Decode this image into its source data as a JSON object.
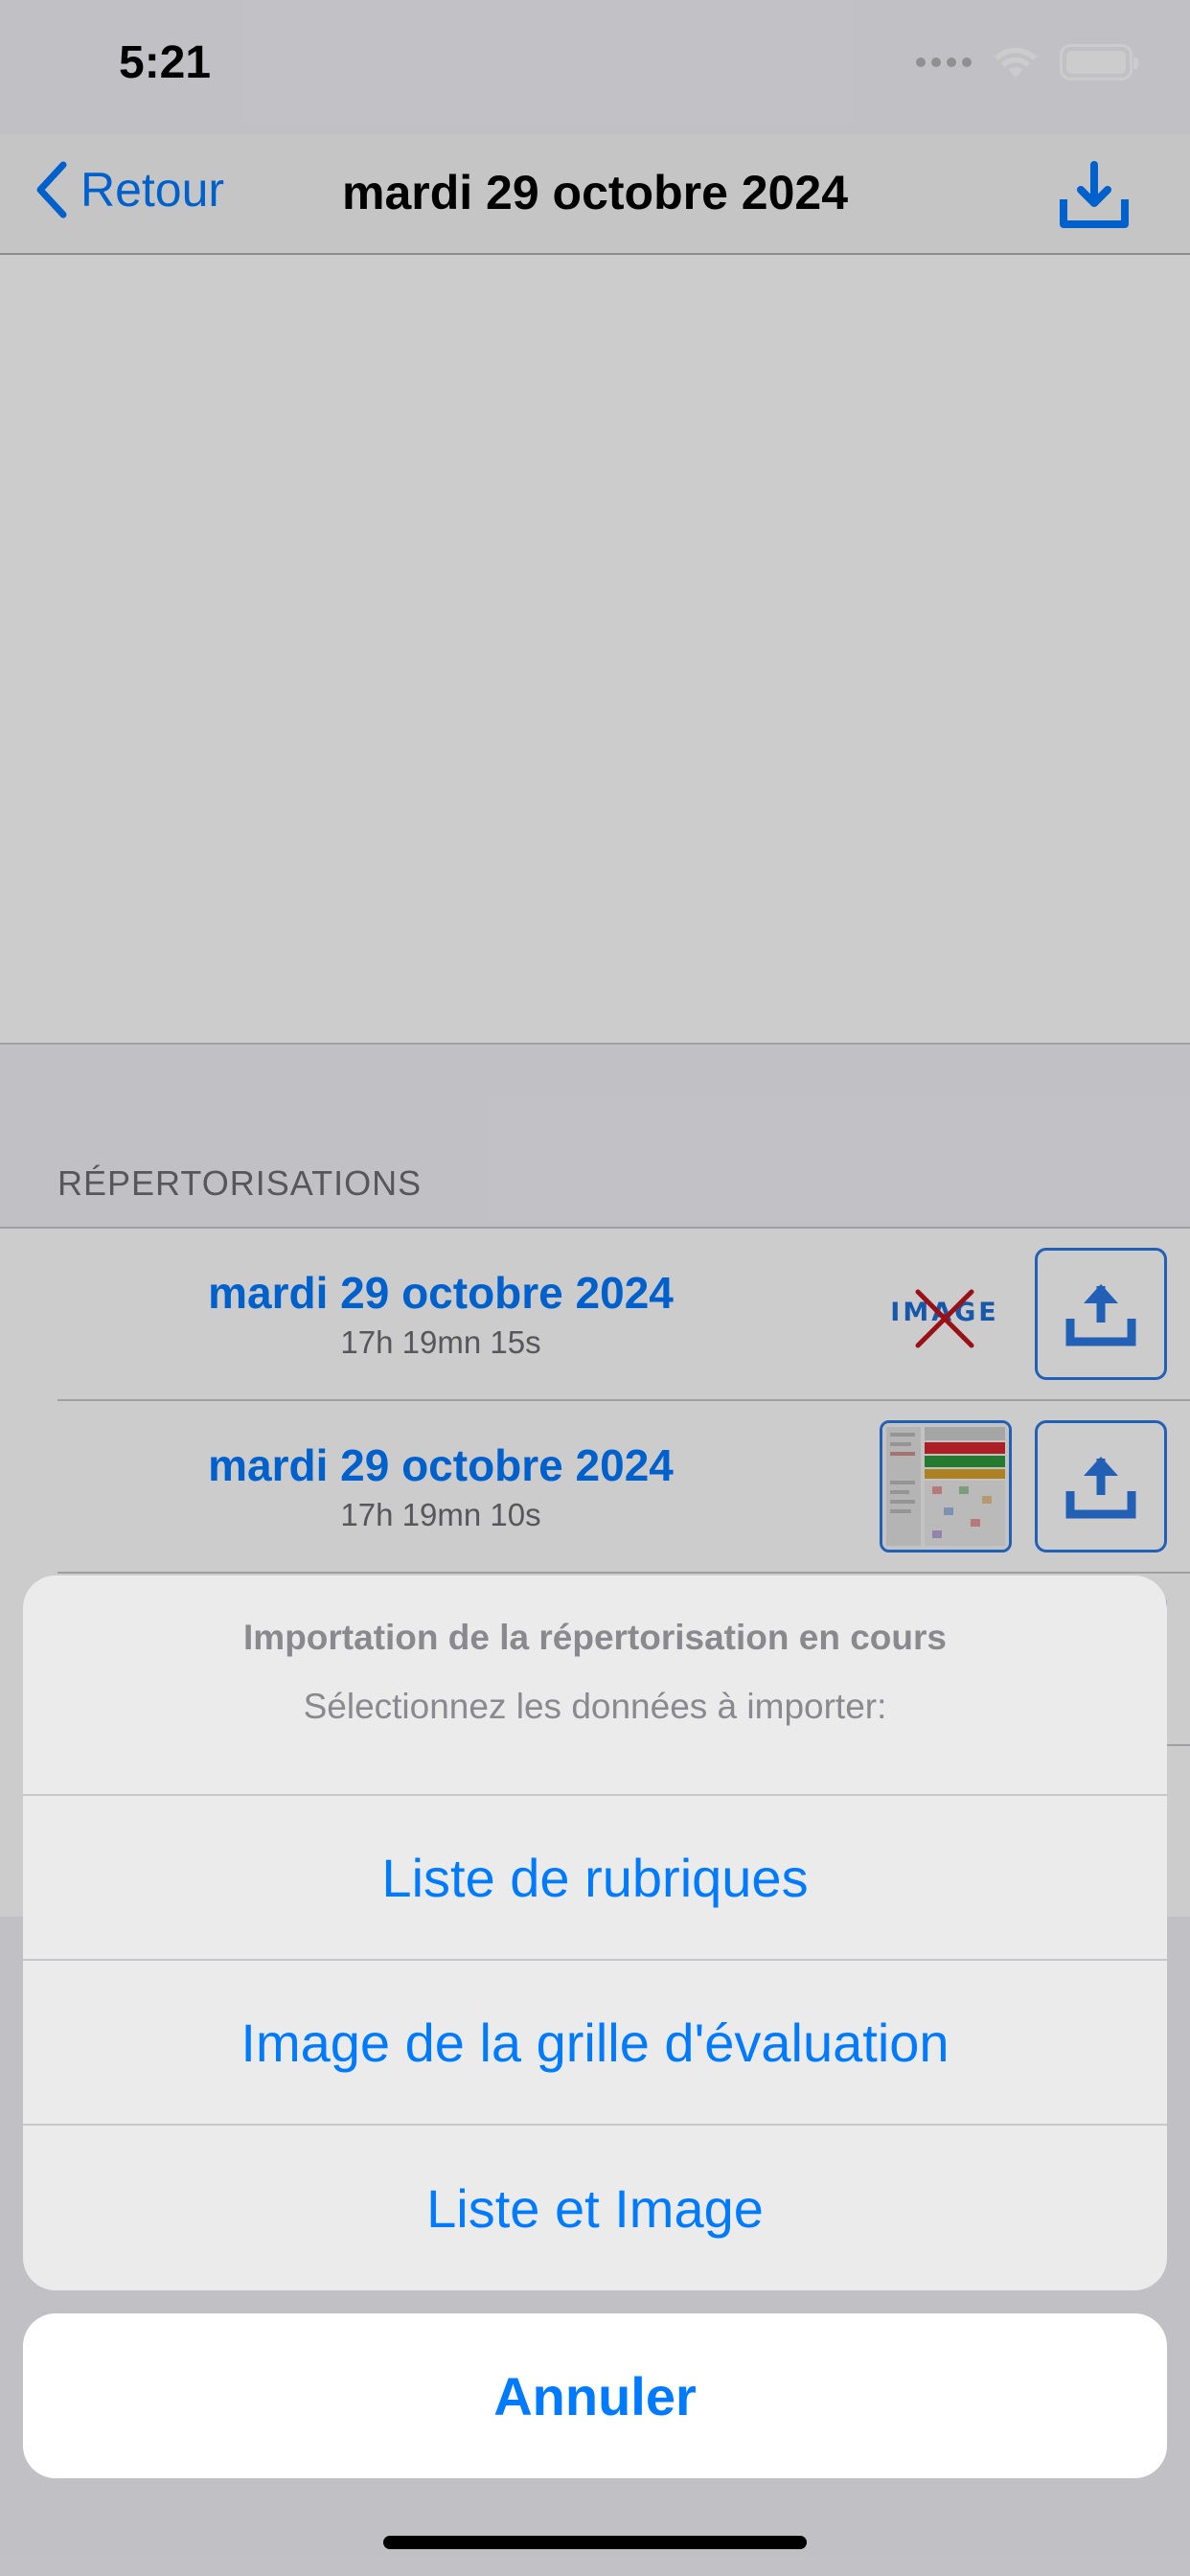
{
  "status_bar": {
    "time": "5:21"
  },
  "nav": {
    "back_label": "Retour",
    "title": "mardi 29 octobre 2024"
  },
  "section": {
    "header": "RÉPERTORISATIONS"
  },
  "rows": [
    {
      "date": "mardi 29 octobre 2024",
      "time": "17h 19mn 15s",
      "image_placeholder": "IMAGE"
    },
    {
      "date": "mardi 29 octobre 2024",
      "time": "17h 19mn 10s"
    }
  ],
  "action_sheet": {
    "title": "Importation de la répertorisation en cours",
    "message": "Sélectionnez les données à importer:",
    "actions": [
      "Liste de rubriques",
      "Image de la grille d'évaluation",
      "Liste et Image"
    ],
    "cancel": "Annuler"
  },
  "colors": {
    "accent": "#007aff",
    "accent_border": "#2b78e4",
    "no_image_cross": "#c0141c"
  }
}
